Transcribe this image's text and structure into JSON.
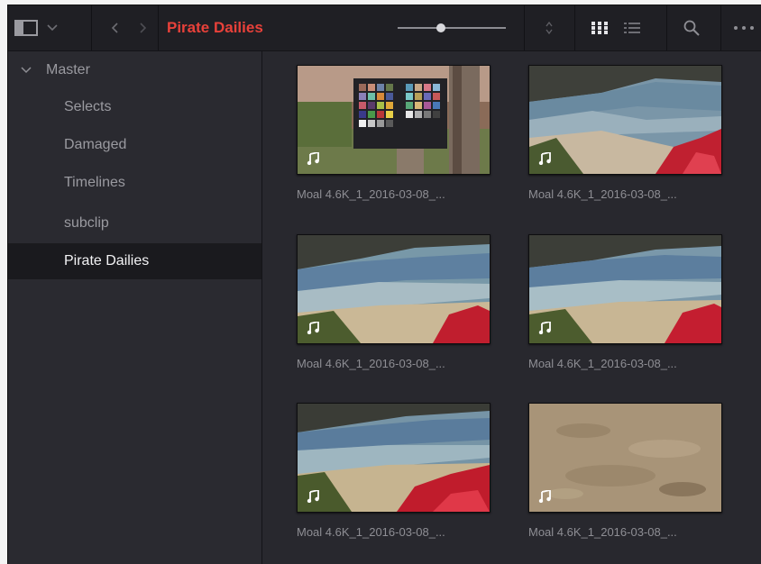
{
  "toolbar": {
    "breadcrumb": "Pirate Dailies",
    "zoom": 0.4
  },
  "sidebar": {
    "master_label": "Master",
    "items": [
      {
        "label": "Selects",
        "selected": false
      },
      {
        "label": "Damaged",
        "selected": false
      },
      {
        "label": "Timelines",
        "selected": false
      },
      {
        "label": "subclip",
        "selected": false
      },
      {
        "label": "Pirate Dailies",
        "selected": true
      }
    ]
  },
  "clips": [
    {
      "name": "Moal 4.6K_1_2016-03-08_...",
      "thumb": "color-chart-icon"
    },
    {
      "name": "Moal 4.6K_1_2016-03-08_...",
      "thumb": "beach-icon"
    },
    {
      "name": "Moal 4.6K_1_2016-03-08_...",
      "thumb": "beach-icon"
    },
    {
      "name": "Moal 4.6K_1_2016-03-08_...",
      "thumb": "beach-icon"
    },
    {
      "name": "Moal 4.6K_1_2016-03-08_...",
      "thumb": "beach-icon"
    },
    {
      "name": "Moal 4.6K_1_2016-03-08_...",
      "thumb": "sand-icon"
    }
  ],
  "colors": {
    "accent": "#e8413a",
    "background": "#28282e",
    "selected_row": "#1a1a1e"
  }
}
